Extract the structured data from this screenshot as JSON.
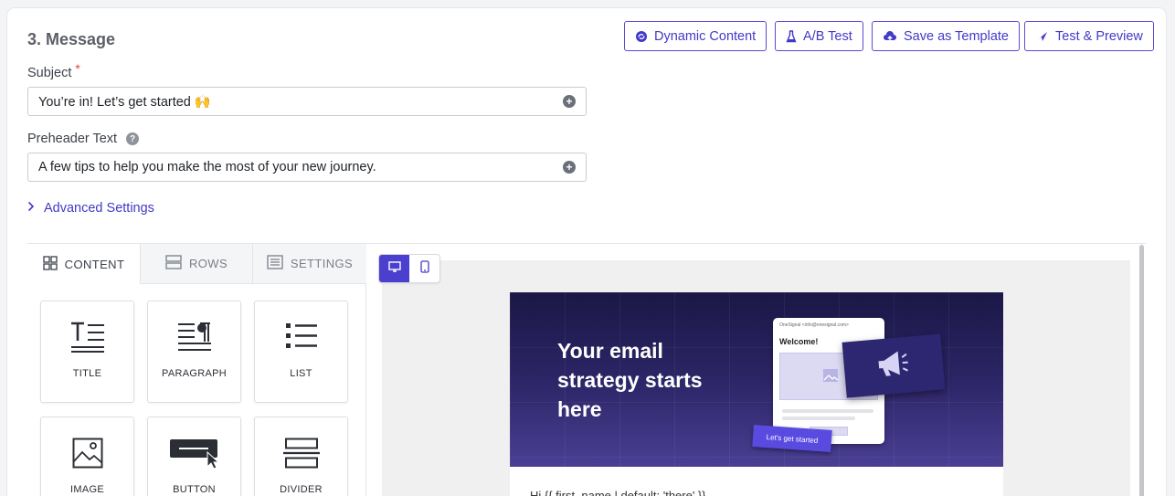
{
  "section": {
    "title": "3. Message"
  },
  "toolbar": {
    "dynamic_content": "Dynamic Content",
    "ab_test": "A/B Test",
    "save_template": "Save as Template",
    "test_preview": "Test & Preview"
  },
  "subject": {
    "label": "Subject",
    "required_mark": "*",
    "value": "You’re in! Let’s get started 🙌"
  },
  "preheader": {
    "label": "Preheader Text",
    "help_mark": "?",
    "value": "A few tips to help you make the most of your new journey."
  },
  "advanced": {
    "label": "Advanced Settings"
  },
  "editor": {
    "tabs": [
      {
        "label": "CONTENT",
        "icon": "grid-icon",
        "active": true
      },
      {
        "label": "ROWS",
        "icon": "rows-icon",
        "active": false
      },
      {
        "label": "SETTINGS",
        "icon": "settings-icon",
        "active": false
      }
    ],
    "blocks": [
      {
        "label": "TITLE",
        "icon": "title-icon"
      },
      {
        "label": "PARAGRAPH",
        "icon": "paragraph-icon"
      },
      {
        "label": "LIST",
        "icon": "list-icon"
      },
      {
        "label": "IMAGE",
        "icon": "image-icon"
      },
      {
        "label": "BUTTON",
        "icon": "button-icon"
      },
      {
        "label": "DIVIDER",
        "icon": "divider-icon"
      }
    ],
    "device_toggle": {
      "selected": "desktop"
    }
  },
  "preview": {
    "hero_heading": "Your email strategy starts here",
    "mock_from": "OneSignal <info@onesignal.com>",
    "mock_welcome": "Welcome!",
    "cta_label": "Let's get started",
    "body_text": "Hi {{ first_name | default: 'there' }}"
  },
  "colors": {
    "accent": "#4339c8",
    "required": "#e0463a",
    "hero_dark": "#1b1746",
    "hero_light": "#4a3f93"
  }
}
